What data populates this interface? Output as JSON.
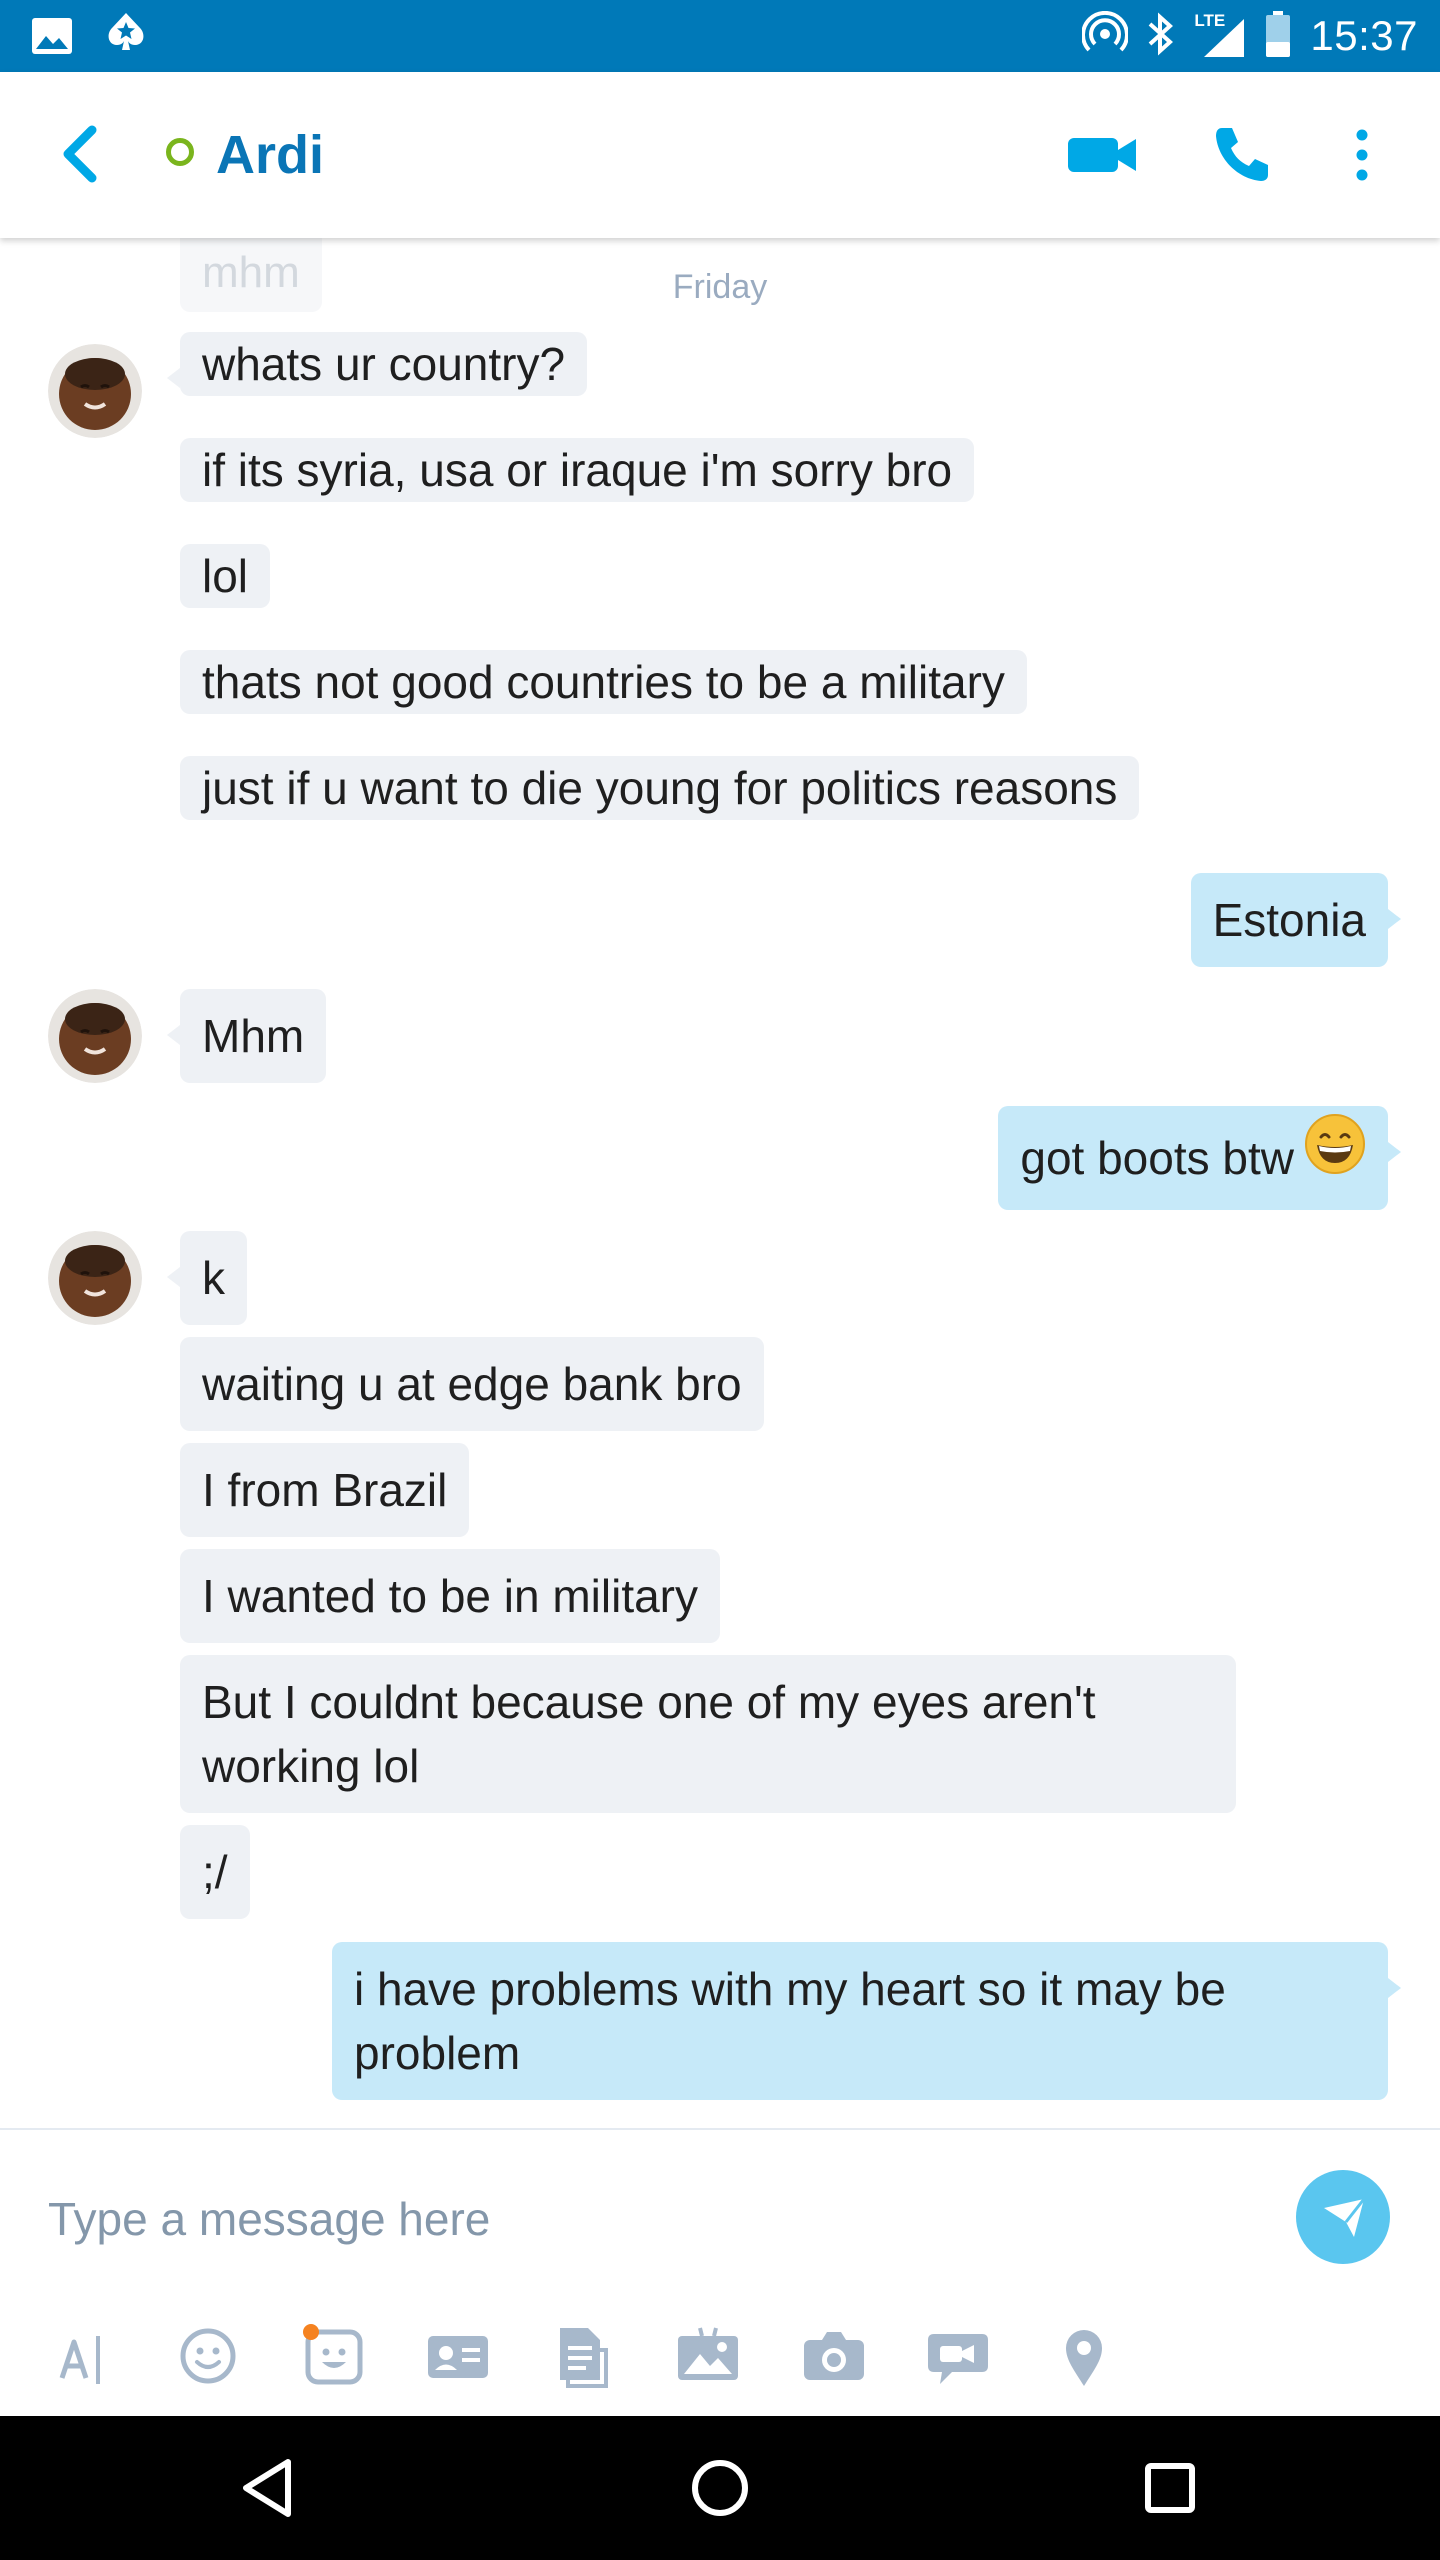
{
  "status_bar": {
    "time": "15:37",
    "network": "LTE"
  },
  "header": {
    "contact_name": "Ardi",
    "presence_color": "#7ab51d"
  },
  "conversation": {
    "ghost_message": "mhm",
    "day_separator": "Friday",
    "messages": [
      {
        "id": "m1",
        "direction": "in",
        "text": "whats ur country?"
      },
      {
        "id": "m2",
        "direction": "in",
        "text": "if its syria, usa or iraque i'm sorry bro"
      },
      {
        "id": "m3",
        "direction": "in",
        "text": "lol"
      },
      {
        "id": "m4",
        "direction": "in",
        "text": "thats not good countries to be a military"
      },
      {
        "id": "m5",
        "direction": "in",
        "text": "just if u want to die young for politics reasons"
      },
      {
        "id": "m6",
        "direction": "out",
        "text": "Estonia"
      },
      {
        "id": "m7",
        "direction": "in",
        "text": "Mhm"
      },
      {
        "id": "m8",
        "direction": "out",
        "text": "got boots btw",
        "emoji": "grinning-face-emoji"
      },
      {
        "id": "m9",
        "direction": "in",
        "text": "k"
      },
      {
        "id": "m10",
        "direction": "in",
        "text": "waiting u at edge bank bro"
      },
      {
        "id": "m11",
        "direction": "in",
        "text": "I from Brazil"
      },
      {
        "id": "m12",
        "direction": "in",
        "text": "I wanted to be in military"
      },
      {
        "id": "m13",
        "direction": "in",
        "text": "But I couldnt because one of my eyes aren't working lol"
      },
      {
        "id": "m14",
        "direction": "in",
        "text": ";/"
      },
      {
        "id": "m15",
        "direction": "out",
        "text": "i have problems with my heart so it may be problem"
      }
    ]
  },
  "composer": {
    "placeholder": "Type a message here",
    "value": "",
    "tools": [
      "text-format-icon",
      "emoticon-icon",
      "mojis-icon",
      "contact-card-icon",
      "file-icon",
      "photo-icon",
      "camera-icon",
      "video-message-icon",
      "location-icon"
    ]
  },
  "colors": {
    "brand": "#0079b8",
    "accent": "#00a8e6",
    "incoming_bubble": "#eef1f5",
    "outgoing_bubble": "#c6e9f9",
    "send_button": "#5ac6ef"
  }
}
